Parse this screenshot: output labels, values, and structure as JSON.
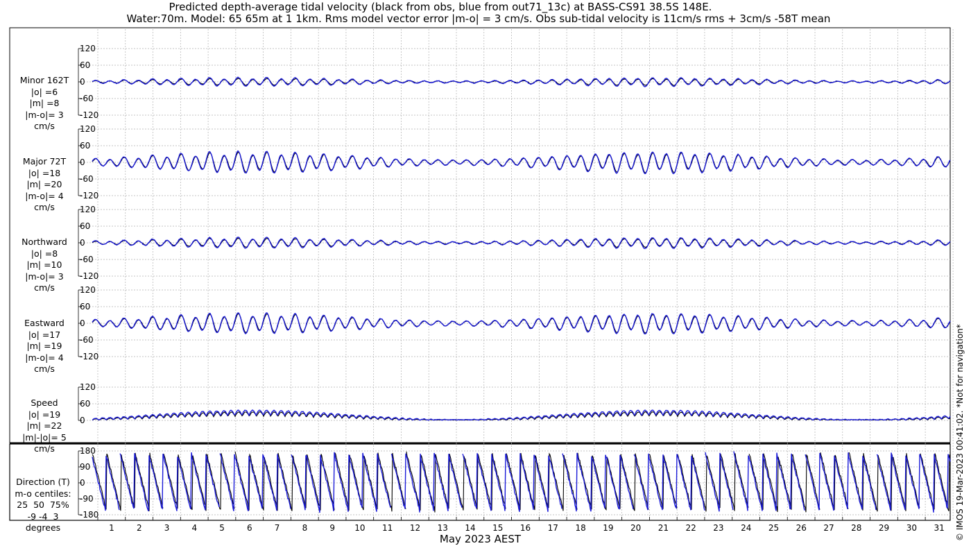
{
  "title_line1": "Predicted depth-average tidal velocity (black from obs, blue from out71_13c) at BASS-CS91 38.5S 148E.",
  "title_line2": "Water:70m. Model: 65 65m at 1 1km. Rms model vector error |m-o| = 3 cm/s. Obs sub-tidal velocity is 11cm/s rms + 3cm/s -58T mean",
  "x_label": "May 2023 AEST",
  "copyright": "© IMOS 19-Mar-2023 00:41:02. *Not for navigation*",
  "colors": {
    "obs": "#000000",
    "model": "#1a1ad8",
    "grid": "#b0b0b0"
  },
  "chart_data": [
    {
      "type": "line",
      "id": "minor",
      "label_lines": [
        "Minor 162T",
        "|o| =6",
        "|m| =8",
        "|m-o|= 3",
        "cm/s"
      ],
      "ylim": [
        -120,
        120
      ],
      "yticks": [
        120,
        60,
        0,
        -60,
        -120
      ],
      "amplitude_obs": 6,
      "amplitude_model": 8,
      "series": [
        {
          "name": "obs"
        },
        {
          "name": "model"
        }
      ]
    },
    {
      "type": "line",
      "id": "major",
      "label_lines": [
        "Major 72T",
        "|o| =18",
        "|m| =20",
        "|m-o|= 4",
        "cm/s"
      ],
      "ylim": [
        -120,
        120
      ],
      "yticks": [
        120,
        60,
        0,
        -60,
        -120
      ],
      "amplitude_obs": 18,
      "amplitude_model": 20,
      "series": [
        {
          "name": "obs"
        },
        {
          "name": "model"
        }
      ]
    },
    {
      "type": "line",
      "id": "north",
      "label_lines": [
        "Northward",
        "|o| =8",
        "|m| =10",
        "|m-o|= 3",
        "cm/s"
      ],
      "ylim": [
        -120,
        120
      ],
      "yticks": [
        120,
        60,
        0,
        -60,
        -120
      ],
      "amplitude_obs": 8,
      "amplitude_model": 10,
      "series": [
        {
          "name": "obs"
        },
        {
          "name": "model"
        }
      ]
    },
    {
      "type": "line",
      "id": "east",
      "label_lines": [
        "Eastward",
        "|o| =17",
        "|m| =19",
        "|m-o|= 4",
        "cm/s"
      ],
      "ylim": [
        -120,
        120
      ],
      "yticks": [
        120,
        60,
        0,
        -60,
        -120
      ],
      "amplitude_obs": 17,
      "amplitude_model": 19,
      "series": [
        {
          "name": "obs"
        },
        {
          "name": "model"
        }
      ]
    },
    {
      "type": "line",
      "id": "speed",
      "label_lines": [
        "Speed",
        "|o| =19",
        "|m| =22",
        "|m|-|o|= 5",
        "cm/s"
      ],
      "ylim": [
        0,
        120
      ],
      "yticks": [
        120,
        60,
        0
      ],
      "amplitude_obs": 19,
      "amplitude_model": 22,
      "series": [
        {
          "name": "obs"
        },
        {
          "name": "model"
        }
      ]
    },
    {
      "type": "line",
      "id": "direction",
      "label_lines": [
        "Direction (T)",
        "m-o centiles:",
        "25  50  75%",
        "-9 -4  3",
        "degrees"
      ],
      "ylim": [
        -180,
        180
      ],
      "yticks": [
        180,
        90,
        0,
        -90,
        -180
      ],
      "series": [
        {
          "name": "obs"
        },
        {
          "name": "model"
        }
      ]
    }
  ],
  "x_ticks": [
    "1",
    "2",
    "3",
    "4",
    "5",
    "6",
    "7",
    "8",
    "9",
    "10",
    "11",
    "12",
    "13",
    "14",
    "15",
    "16",
    "17",
    "18",
    "19",
    "20",
    "21",
    "22",
    "23",
    "24",
    "25",
    "26",
    "27",
    "28",
    "29",
    "30",
    "31"
  ]
}
